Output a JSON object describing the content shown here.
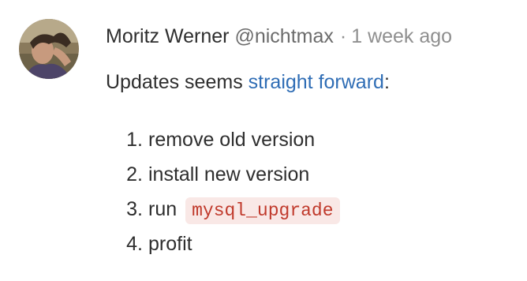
{
  "comment": {
    "author": {
      "name": "Moritz Werner",
      "handle": "@nichtmax",
      "avatar_icon": "user-avatar-photo"
    },
    "separator": "·",
    "timestamp": "1 week ago",
    "body": {
      "intro_before_link": "Updates seems ",
      "link_text": "straight forward",
      "intro_after_link": ":",
      "steps": [
        {
          "number": "1.",
          "text": "remove old version"
        },
        {
          "number": "2.",
          "text": "install new version"
        },
        {
          "number": "3.",
          "text": "run",
          "code": "mysql_upgrade"
        },
        {
          "number": "4.",
          "text": "profit"
        }
      ]
    }
  },
  "colors": {
    "text": "#2e2e2e",
    "muted": "#8f8f8f",
    "link": "#2f6db5",
    "code_text": "#c0392b",
    "code_bg": "#f9e8e6"
  }
}
